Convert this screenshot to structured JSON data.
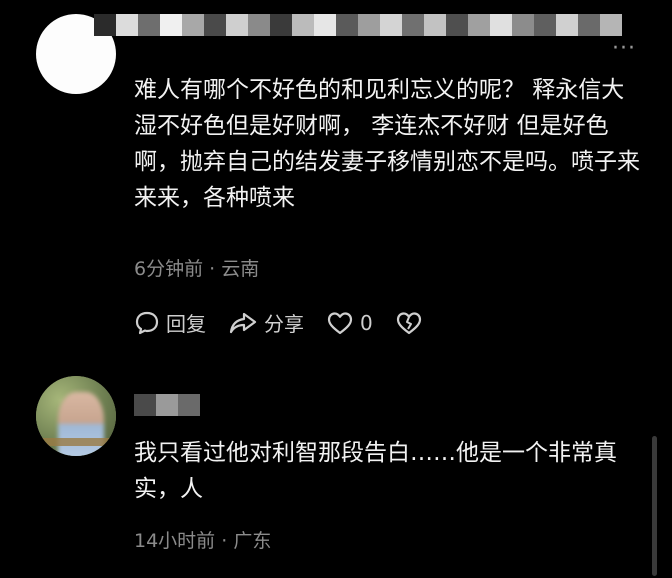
{
  "comments": [
    {
      "text": "难人有哪个不好色的和见利忘义的呢？ 释永信大湿不好色但是好财啊， 李连杰不好财 但是好色啊，抛弃自己的结发妻子移情别恋不是吗。喷子来来来，各种喷来",
      "time": "6分钟前",
      "location": "云南",
      "meta_separator": " · ",
      "actions": {
        "reply": "回复",
        "share": "分享",
        "like_count": "0"
      },
      "more": "···"
    },
    {
      "text": "我只看过他对利智那段告白……他是一个非常真实，人",
      "time": "14小时前",
      "location": "广东",
      "meta_separator": " · "
    }
  ],
  "icons": [
    "reply-icon",
    "share-icon",
    "like-icon",
    "dislike-icon",
    "more-icon"
  ],
  "colors": {
    "background": "#000000",
    "text": "#f2f2f2",
    "meta": "#8b8b8b"
  }
}
